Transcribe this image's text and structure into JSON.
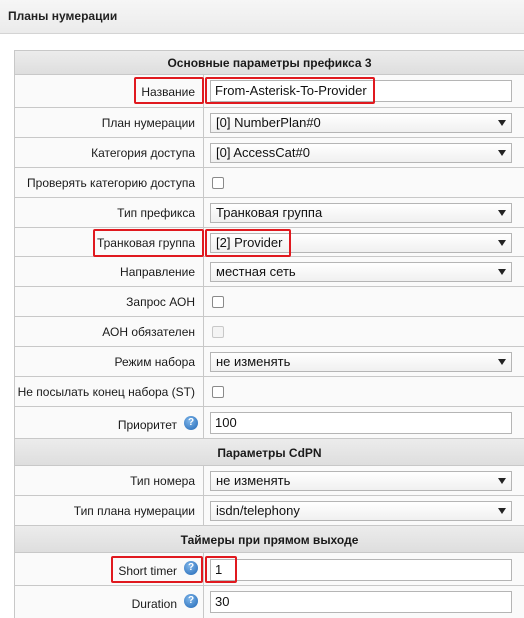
{
  "page": {
    "title": "Планы нумерации"
  },
  "sections": {
    "main": "Основные параметры префикса 3",
    "cdpn": "Параметры CdPN",
    "timers": "Таймеры при прямом выходе"
  },
  "fields": {
    "name": {
      "label": "Название",
      "value": "From-Asterisk-To-Provider"
    },
    "numbering_plan": {
      "label": "План нумерации",
      "value": "[0] NumberPlan#0"
    },
    "access_category": {
      "label": "Категория доступа",
      "value": "[0] AccessCat#0"
    },
    "check_access_category": {
      "label": "Проверять категорию доступа",
      "checked": false
    },
    "prefix_type": {
      "label": "Тип префикса",
      "value": "Транковая группа"
    },
    "trunk_group": {
      "label": "Транковая группа",
      "value": "[2] Provider"
    },
    "direction": {
      "label": "Направление",
      "value": "местная сеть"
    },
    "aon_request": {
      "label": "Запрос АОН",
      "checked": false
    },
    "aon_required": {
      "label": "АОН обязателен",
      "checked": false,
      "disabled": true
    },
    "dial_mode": {
      "label": "Режим набора",
      "value": "не изменять"
    },
    "no_end_of_dial": {
      "label": "Не посылать конец набора (ST)",
      "checked": false
    },
    "priority": {
      "label": "Приоритет",
      "value": "100"
    },
    "number_type": {
      "label": "Тип номера",
      "value": "не изменять"
    },
    "numbering_plan_type": {
      "label": "Тип плана нумерации",
      "value": "isdn/telephony"
    },
    "short_timer": {
      "label": "Short timer",
      "value": "1"
    },
    "duration": {
      "label": "Duration",
      "value": "30"
    }
  },
  "help_glyph": "?",
  "icons": {
    "help": "help-circle-icon",
    "dropdown": "chevron-down-icon"
  },
  "colors": {
    "highlight": "#e0191f",
    "help_icon": "#1f66b5"
  }
}
